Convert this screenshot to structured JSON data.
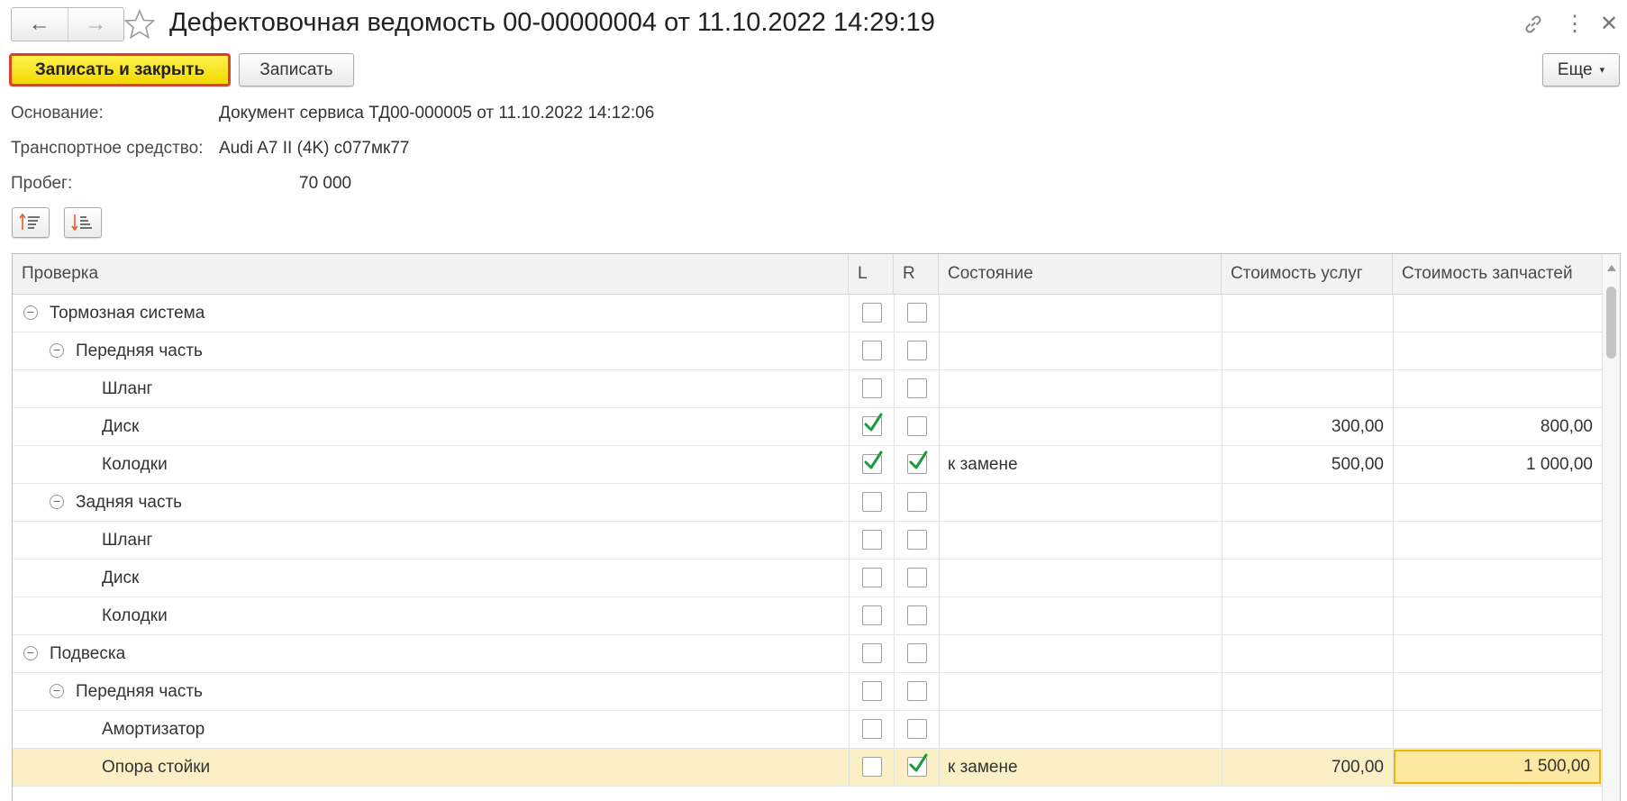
{
  "window": {
    "title": "Дефектовочная ведомость 00-00000004 от 11.10.2022 14:29:19",
    "back_icon": "←",
    "forward_icon": "→",
    "link_icon": "🔗",
    "menu_icon": "⋮",
    "close_icon": "✕"
  },
  "toolbar": {
    "save_close_label": "Записать и закрыть",
    "save_label": "Записать",
    "more_label": "Еще"
  },
  "fields": {
    "basis_label": "Основание:",
    "basis_value": "Документ сервиса ТД00-000005 от 11.10.2022 14:12:06",
    "vehicle_label": "Транспортное средство:",
    "vehicle_value": "Audi A7 II (4K) с077мк77",
    "mileage_label": "Пробег:",
    "mileage_value": "70 000"
  },
  "table": {
    "headers": {
      "check": "Проверка",
      "l": "L",
      "r": "R",
      "state": "Состояние",
      "service_cost": "Стоимость услуг",
      "parts_cost": "Стоимость запчастей"
    },
    "rows": [
      {
        "name": "Тормозная система",
        "level": 0,
        "group": true,
        "l": false,
        "r": false,
        "state": "",
        "service": "",
        "parts": ""
      },
      {
        "name": "Передняя часть",
        "level": 1,
        "group": true,
        "l": false,
        "r": false,
        "state": "",
        "service": "",
        "parts": ""
      },
      {
        "name": "Шланг",
        "level": 2,
        "group": false,
        "l": false,
        "r": false,
        "state": "",
        "service": "",
        "parts": ""
      },
      {
        "name": "Диск",
        "level": 2,
        "group": false,
        "l": true,
        "r": false,
        "state": "",
        "service": "300,00",
        "parts": "800,00"
      },
      {
        "name": "Колодки",
        "level": 2,
        "group": false,
        "l": true,
        "r": true,
        "state": "к замене",
        "service": "500,00",
        "parts": "1 000,00"
      },
      {
        "name": "Задняя часть",
        "level": 1,
        "group": true,
        "l": false,
        "r": false,
        "state": "",
        "service": "",
        "parts": ""
      },
      {
        "name": "Шланг",
        "level": 2,
        "group": false,
        "l": false,
        "r": false,
        "state": "",
        "service": "",
        "parts": ""
      },
      {
        "name": "Диск",
        "level": 2,
        "group": false,
        "l": false,
        "r": false,
        "state": "",
        "service": "",
        "parts": ""
      },
      {
        "name": "Колодки",
        "level": 2,
        "group": false,
        "l": false,
        "r": false,
        "state": "",
        "service": "",
        "parts": ""
      },
      {
        "name": "Подвеска",
        "level": 0,
        "group": true,
        "l": false,
        "r": false,
        "state": "",
        "service": "",
        "parts": ""
      },
      {
        "name": "Передняя часть",
        "level": 1,
        "group": true,
        "l": false,
        "r": false,
        "state": "",
        "service": "",
        "parts": ""
      },
      {
        "name": "Амортизатор",
        "level": 2,
        "group": false,
        "l": false,
        "r": false,
        "state": "",
        "service": "",
        "parts": ""
      },
      {
        "name": "Опора стойки",
        "level": 2,
        "group": false,
        "l": false,
        "r": true,
        "state": "к замене",
        "service": "700,00",
        "parts": "1 500,00",
        "selected": true
      }
    ]
  },
  "colors": {
    "primary_button": "#f3d800",
    "primary_border": "#e0402a",
    "check_green": "#1a9c3e",
    "selected_row": "#fbefc5"
  }
}
